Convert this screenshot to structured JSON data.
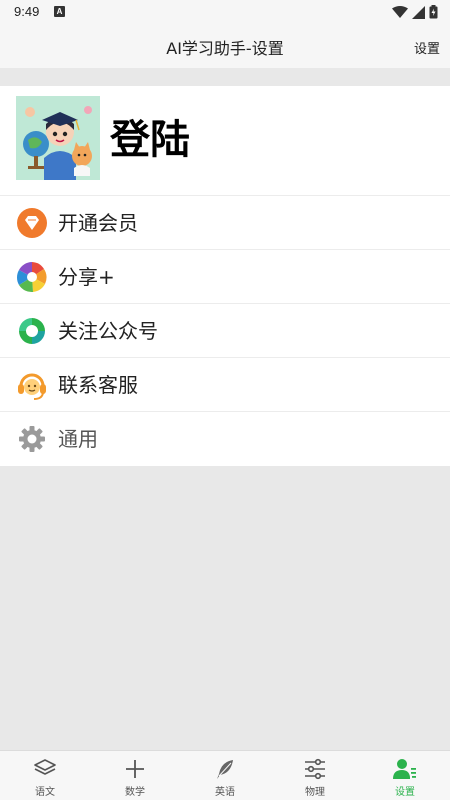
{
  "status": {
    "time": "9:49",
    "notif_letter": "A"
  },
  "header": {
    "title": "AI学习助手-设置",
    "action": "设置"
  },
  "profile": {
    "login_label": "登陆"
  },
  "menu": [
    {
      "label": "开通会员",
      "icon": "diamond-icon"
    },
    {
      "label": "分享+",
      "icon": "aperture-icon"
    },
    {
      "label": "关注公众号",
      "icon": "wechat-mp-icon"
    },
    {
      "label": "联系客服",
      "icon": "headset-icon"
    },
    {
      "label": "通用",
      "icon": "gear-icon"
    }
  ],
  "tabs": [
    {
      "label": "语文",
      "icon": "layers-icon"
    },
    {
      "label": "数学",
      "icon": "plus-icon"
    },
    {
      "label": "英语",
      "icon": "feather-icon"
    },
    {
      "label": "物理",
      "icon": "sliders-icon"
    },
    {
      "label": "设置",
      "icon": "user-settings-icon",
      "active": true
    }
  ],
  "colors": {
    "accent": "#2bb24c",
    "background": "#e8e8e8"
  }
}
